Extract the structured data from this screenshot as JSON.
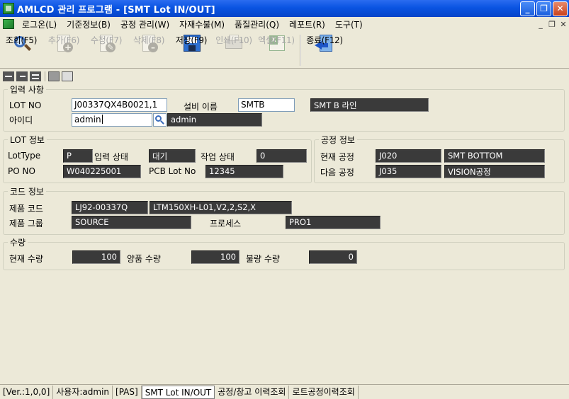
{
  "window": {
    "title": "AMLCD 관리 프로그램 - [SMT Lot IN/OUT]",
    "controls": {
      "minimize": "_",
      "restore": "❐",
      "close": "✕"
    }
  },
  "menu": {
    "items": [
      "로그온(L)",
      "기준정보(B)",
      "공정 관리(W)",
      "자재수불(M)",
      "품질관리(Q)",
      "레포트(R)",
      "도구(T)"
    ],
    "mdi_controls": {
      "minimize": "_",
      "restore": "❐",
      "close": "✕"
    }
  },
  "toolbar": {
    "search": {
      "label": "조회(F5)",
      "icon": "search-icon",
      "enabled": true
    },
    "add": {
      "label": "추가(F6)",
      "icon": "add-icon",
      "enabled": false
    },
    "edit": {
      "label": "수정(F7)",
      "icon": "edit-icon",
      "enabled": false
    },
    "delete": {
      "label": "삭제(F8)",
      "icon": "delete-icon",
      "enabled": false
    },
    "save": {
      "label": "저장(F9)",
      "icon": "save-icon",
      "enabled": true
    },
    "print": {
      "label": "인쇄(F10)",
      "icon": "print-icon",
      "enabled": false
    },
    "excel": {
      "label": "엑셀(F11)",
      "icon": "excel-icon",
      "enabled": false
    },
    "exit": {
      "label": "종료(F12)",
      "icon": "exit-icon",
      "enabled": true
    }
  },
  "input_section": {
    "legend": "입력 사항",
    "lot_no_label": "LOT NO",
    "lot_no_value": "J00337QX4B0021,1",
    "equipment_label": "설비 이름",
    "equipment_value": "SMTB",
    "equipment_desc": "SMT B 라인",
    "id_label": "아이디",
    "id_value": "admin",
    "id_name": "admin"
  },
  "lot_info": {
    "legend": "LOT 정보",
    "lottype_label": "LotType",
    "lottype_value": "P",
    "input_state_label": "입력 상태",
    "input_state_value": "대기",
    "work_state_label": "작업 상태",
    "work_state_value": "0",
    "po_label": "PO NO",
    "po_value": "W040225001",
    "pcb_label": "PCB Lot No",
    "pcb_value": "12345"
  },
  "process_info": {
    "legend": "공정 정보",
    "current_label": "현재 공정",
    "current_code": "J020",
    "current_name": "SMT BOTTOM",
    "next_label": "다음 공정",
    "next_code": "J035",
    "next_name": "VISION공정"
  },
  "code_info": {
    "legend": "코드 정보",
    "product_code_label": "제품 코드",
    "product_code": "LJ92-00337Q",
    "product_desc": "LTM150XH-L01,V2,2,S2,X",
    "product_group_label": "제품 그룹",
    "product_group": "SOURCE",
    "process_label": "프로세스",
    "process_value": "PRO1"
  },
  "quantity": {
    "legend": "수량",
    "current_label": "현재 수량",
    "current_value": "100",
    "good_label": "양품 수량",
    "good_value": "100",
    "bad_label": "불량 수량",
    "bad_value": "0"
  },
  "statusbar": {
    "version": "[Ver.:1,0,0]",
    "user": "사용자:admin",
    "system": "[PAS]",
    "tabs": [
      "SMT Lot IN/OUT",
      "공정/창고 이력조회",
      "로트공정이력조회"
    ]
  },
  "colors": {
    "titlebar": "#0a54e2",
    "window_bg": "#ece9d8",
    "readonly_field": "#3a3a3a"
  }
}
